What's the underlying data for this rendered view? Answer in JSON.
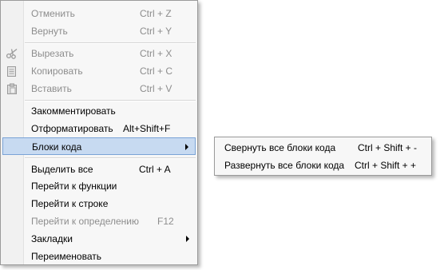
{
  "menu": {
    "items": [
      {
        "label": "Отменить",
        "shortcut": "Ctrl + Z"
      },
      {
        "label": "Вернуть",
        "shortcut": "Ctrl + Y"
      },
      {
        "label": "Вырезать",
        "shortcut": "Ctrl + X",
        "icon": "scissors-icon"
      },
      {
        "label": "Копировать",
        "shortcut": "Ctrl + C",
        "icon": "copy-icon"
      },
      {
        "label": "Вставить",
        "shortcut": "Ctrl + V",
        "icon": "paste-icon"
      },
      {
        "label": "Закомментировать"
      },
      {
        "label": "Отформатировать",
        "shortcut": "Alt+Shift+F"
      },
      {
        "label": "Блоки кода",
        "has_submenu": true,
        "highlighted": true
      },
      {
        "label": "Выделить все",
        "shortcut": "Ctrl + A"
      },
      {
        "label": "Перейти к функции"
      },
      {
        "label": "Перейти к строке"
      },
      {
        "label": "Перейти к определению",
        "shortcut": "F12"
      },
      {
        "label": "Закладки",
        "has_submenu": true
      },
      {
        "label": "Переименовать"
      }
    ]
  },
  "submenu": {
    "items": [
      {
        "label": "Свернуть все блоки кода",
        "shortcut": "Ctrl + Shift + -"
      },
      {
        "label": "Развернуть все блоки кода",
        "shortcut": "Ctrl + Shift + +"
      }
    ]
  },
  "colors": {
    "menu_bg": "#f7f7f7",
    "highlight_bg": "#c7daf1",
    "highlight_border": "#7aa3d6",
    "disabled_text": "#8d8d8d"
  }
}
